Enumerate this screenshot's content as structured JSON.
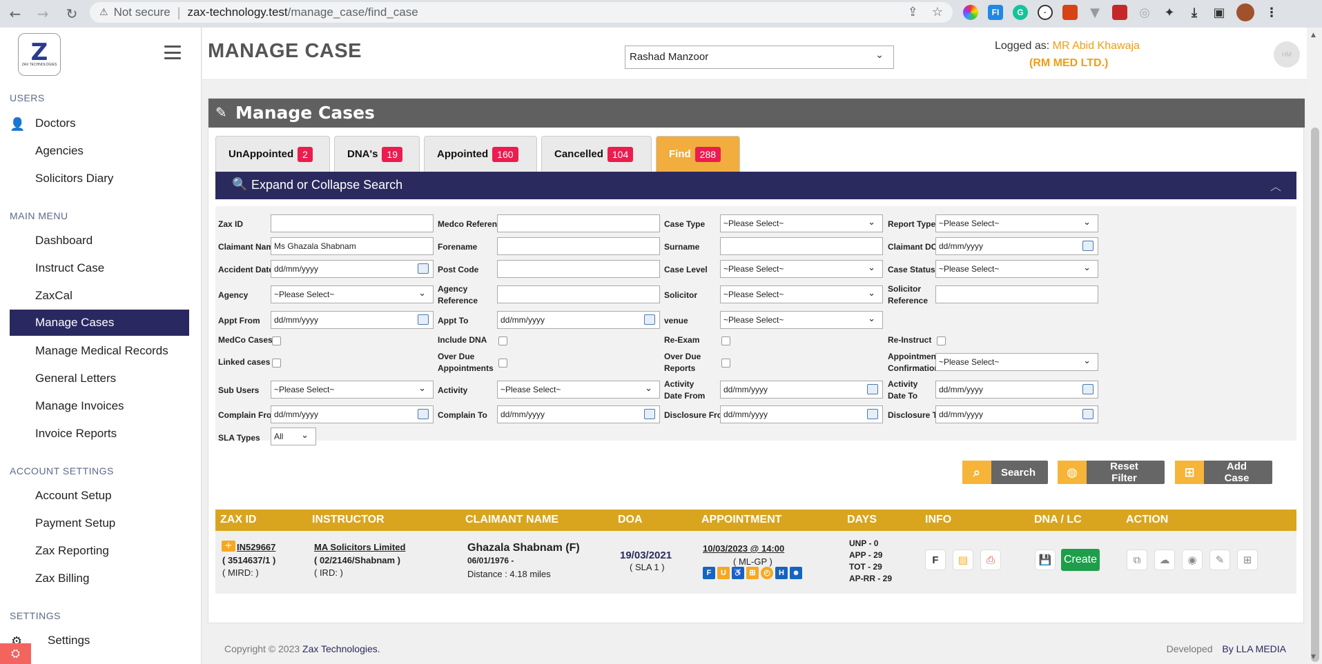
{
  "browser": {
    "security": "Not secure",
    "url_host": "zax-technology.test",
    "url_path": "/manage_case/find_case"
  },
  "sidebar": {
    "sections": [
      {
        "label": "USERS"
      },
      {
        "label": "MAIN MENU"
      },
      {
        "label": "ACCOUNT SETTINGS"
      },
      {
        "label": "SETTINGS"
      }
    ],
    "items": [
      {
        "label": "Doctors"
      },
      {
        "label": "Agencies"
      },
      {
        "label": "Solicitors Diary"
      },
      {
        "label": "Dashboard"
      },
      {
        "label": "Instruct Case"
      },
      {
        "label": "ZaxCal"
      },
      {
        "label": "Manage Cases"
      },
      {
        "label": "Manage Medical Records"
      },
      {
        "label": "General Letters"
      },
      {
        "label": "Manage Invoices"
      },
      {
        "label": "Invoice Reports"
      },
      {
        "label": "Account Setup"
      },
      {
        "label": "Payment Setup"
      },
      {
        "label": "Zax Reporting"
      },
      {
        "label": "Zax Billing"
      },
      {
        "label": "Settings"
      }
    ]
  },
  "header": {
    "title": "MANAGE CASE",
    "user_select": "Rashad Manzoor",
    "logged_label": "Logged as:",
    "logged_name": "MR Abid Khawaja",
    "company": "(RM MED LTD.)",
    "avatar_text": "HM"
  },
  "panel": {
    "title": "Manage Cases",
    "tabs": [
      {
        "label": "UnAppointed",
        "count": "2"
      },
      {
        "label": "DNA's",
        "count": "19"
      },
      {
        "label": "Appointed",
        "count": "160"
      },
      {
        "label": "Cancelled",
        "count": "104"
      },
      {
        "label": "Find",
        "count": "288"
      }
    ],
    "expand_label": "Expand or Collapse Search"
  },
  "filters": {
    "labels": {
      "zax_id": "Zax ID",
      "medco_ref": "Medco Reference",
      "case_type": "Case Type",
      "report_type": "Report Type",
      "claimant_name": "Claimant Name",
      "forename": "Forename",
      "surname": "Surname",
      "claimant_dob": "Claimant DOB",
      "accident_date": "Accident Date",
      "post_code": "Post Code",
      "case_level": "Case Level",
      "case_status": "Case Status",
      "agency": "Agency",
      "agency_ref_1": "Agency",
      "agency_ref_2": "Reference",
      "solicitor": "Solicitor",
      "solicitor_ref_1": "Solicitor",
      "solicitor_ref_2": "Reference",
      "appt_from": "Appt From",
      "appt_to": "Appt To",
      "venue": "venue",
      "medco_cases": "MedCo Cases",
      "include_dna": "Include DNA",
      "re_exam": "Re-Exam",
      "re_instruct": "Re-Instruct",
      "linked_cases": "Linked cases",
      "over_due_appt_1": "Over Due",
      "over_due_appt_2": "Appointments",
      "over_due_rep_1": "Over Due",
      "over_due_rep_2": "Reports",
      "appt_conf_1": "Appointment",
      "appt_conf_2": "Confirmation",
      "sub_users": "Sub Users",
      "activity": "Activity",
      "act_from_1": "Activity",
      "act_from_2": "Date From",
      "act_to_1": "Activity",
      "act_to_2": "Date To",
      "complain_from": "Complain From",
      "complain_to": "Complain To",
      "disclosure_from": "Disclosure From",
      "disclosure_to": "Disclosure To",
      "sla_types": "SLA Types"
    },
    "values": {
      "claimant_name": "Ms Ghazala Shabnam",
      "please_select": "~Please Select~",
      "date_placeholder": "dd/mm/yyyy",
      "sla": "All"
    },
    "buttons": {
      "search": "Search",
      "reset": "Reset Filter",
      "add": "Add Case"
    }
  },
  "table": {
    "headers": [
      "ZAX ID",
      "INSTRUCTOR",
      "CLAIMANT NAME",
      "DOA",
      "APPOINTMENT",
      "DAYS",
      "INFO",
      "DNA / LC",
      "ACTION"
    ],
    "row": {
      "zax_id": "IN529667",
      "zax_sub": "( 3514637/1 )",
      "mird": "( MIRD: )",
      "instructor": "MA Solicitors Limited",
      "instructor_ref": "( 02/2146/Shabnam )",
      "ird": "( IRD: )",
      "claimant": "Ghazala Shabnam (F)",
      "claimant_dob": "06/01/1976 -",
      "distance": "Distance : 4.18 miles",
      "doa": "19/03/2021",
      "sla": "( SLA 1 )",
      "appointment": "10/03/2023 @ 14:00",
      "appt_type": "( ML-GP )",
      "days": [
        "UNP - 0",
        "APP - 29",
        "TOT - 29",
        "AP-RR - 29"
      ],
      "info_f": "F",
      "create": "Create"
    }
  },
  "footer": {
    "copyright": "Copyright © 2023",
    "company": "Zax Technologies.",
    "developed": "Developed",
    "by": "By LLA MEDIA"
  }
}
